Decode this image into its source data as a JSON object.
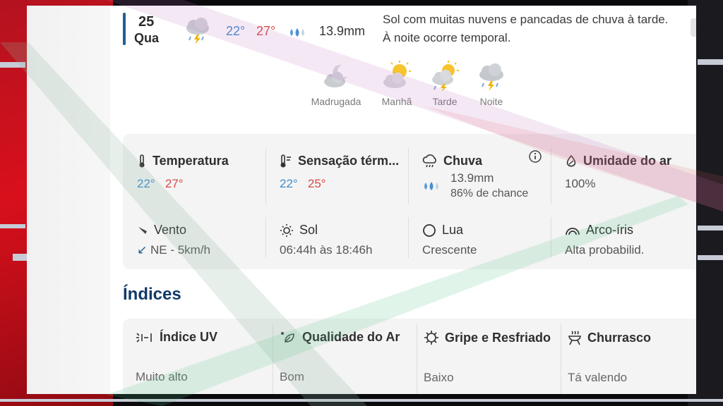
{
  "day": {
    "number": "25",
    "weekday": "Qua",
    "temp_min": "22°",
    "temp_max": "27°",
    "rain": "13.9mm",
    "description": "Sol com muitas nuvens e pancadas de chuva à tarde. À noite ocorre temporal.",
    "icon": "thunderstorm-icon"
  },
  "periods": [
    {
      "label": "Madrugada",
      "icon": "moon-cloud-icon"
    },
    {
      "label": "Manhã",
      "icon": "sun-cloud-icon"
    },
    {
      "label": "Tarde",
      "icon": "sun-cloud-lightning-icon"
    },
    {
      "label": "Noite",
      "icon": "thunderstorm-icon"
    }
  ],
  "conditions": {
    "temperature": {
      "label": "Temperatura",
      "min": "22°",
      "max": "27°"
    },
    "feels_like": {
      "label": "Sensação térm...",
      "min": "22°",
      "max": "25°"
    },
    "rain": {
      "label": "Chuva",
      "amount": "13.9mm",
      "chance": "86% de chance"
    },
    "humidity": {
      "label": "Umidade do ar",
      "value": "100%"
    },
    "wind": {
      "label": "Vento",
      "value": "NE - 5km/h",
      "arrow": "↙"
    },
    "sun": {
      "label": "Sol",
      "value": "06:44h às 18:46h"
    },
    "moon": {
      "label": "Lua",
      "value": "Crescente"
    },
    "rainbow": {
      "label": "Arco-íris",
      "value": "Alta probabilid."
    }
  },
  "indices": {
    "title": "Índices",
    "items": [
      {
        "label": "Índice UV",
        "value": "Muito alto",
        "icon": "uv-icon"
      },
      {
        "label": "Qualidade do Ar",
        "value": "Bom",
        "icon": "leaf-icon"
      },
      {
        "label": "Gripe e Resfriado",
        "value": "Baixo",
        "icon": "virus-icon"
      },
      {
        "label": "Churrasco",
        "value": "Tá valendo",
        "icon": "grill-icon"
      }
    ]
  },
  "colors": {
    "accent_blue": "#1f5f95",
    "temp_min": "#3d8ccf",
    "temp_max": "#d84a44",
    "title_navy": "#123a66"
  }
}
